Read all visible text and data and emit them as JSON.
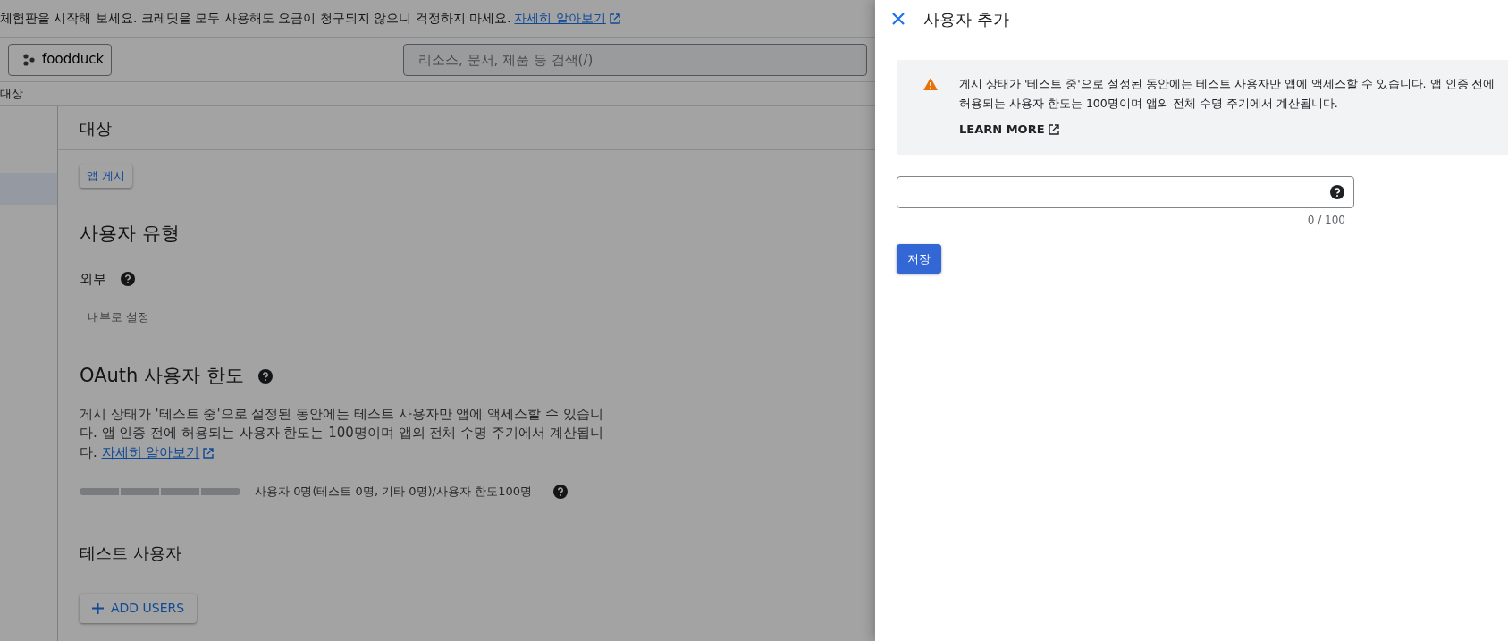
{
  "banner": {
    "text": "체험판을 시작해 보세요. 크레딧을 모두 사용해도 요금이 청구되지 않으니 걱정하지 마세요.",
    "link": "자세히 알아보기"
  },
  "project_button": "foodduck",
  "search": {
    "placeholder": "리소스, 문서, 제품 등 검색(/)"
  },
  "breadcrumb": "대상",
  "sidebar": {
    "items": [
      {
        "selected": true
      }
    ]
  },
  "page_title": "대상",
  "publish_button": "앱 게시",
  "user_type": {
    "heading": "사용자 유형",
    "value": "외부",
    "switch_button": "내부로 설정"
  },
  "oauth_limit": {
    "heading": "OAuth 사용자 한도",
    "description": "게시 상태가 '테스트 중'으로 설정된 동안에는 테스트 사용자만 앱에 액세스할 수 있습니다. 앱 인증 전에 허용되는 사용자 한도는 100명이며 앱의 전체 수명 주기에서 계산됩니다.",
    "link": "자세히 알아보기",
    "level": 0,
    "usage": "사용자 0명(테스트 0명, 기타 0명)/사용자 한도100명"
  },
  "test_users": {
    "heading": "테스트 사용자",
    "add_button": "ADD USERS"
  },
  "panel": {
    "title": "사용자 추가",
    "alert": {
      "text": "게시 상태가 '테스트 중'으로 설정된 동안에는 테스트 사용자만 앱에 액세스할 수 있습니다. 앱 인증 전에 허용되는 사용자 한도는 100명이며 앱의 전체 수명 주기에서 계산됩니다.",
      "link": "LEARN MORE"
    },
    "field": {
      "counter": "0 / 100"
    },
    "save_button": "저장"
  }
}
